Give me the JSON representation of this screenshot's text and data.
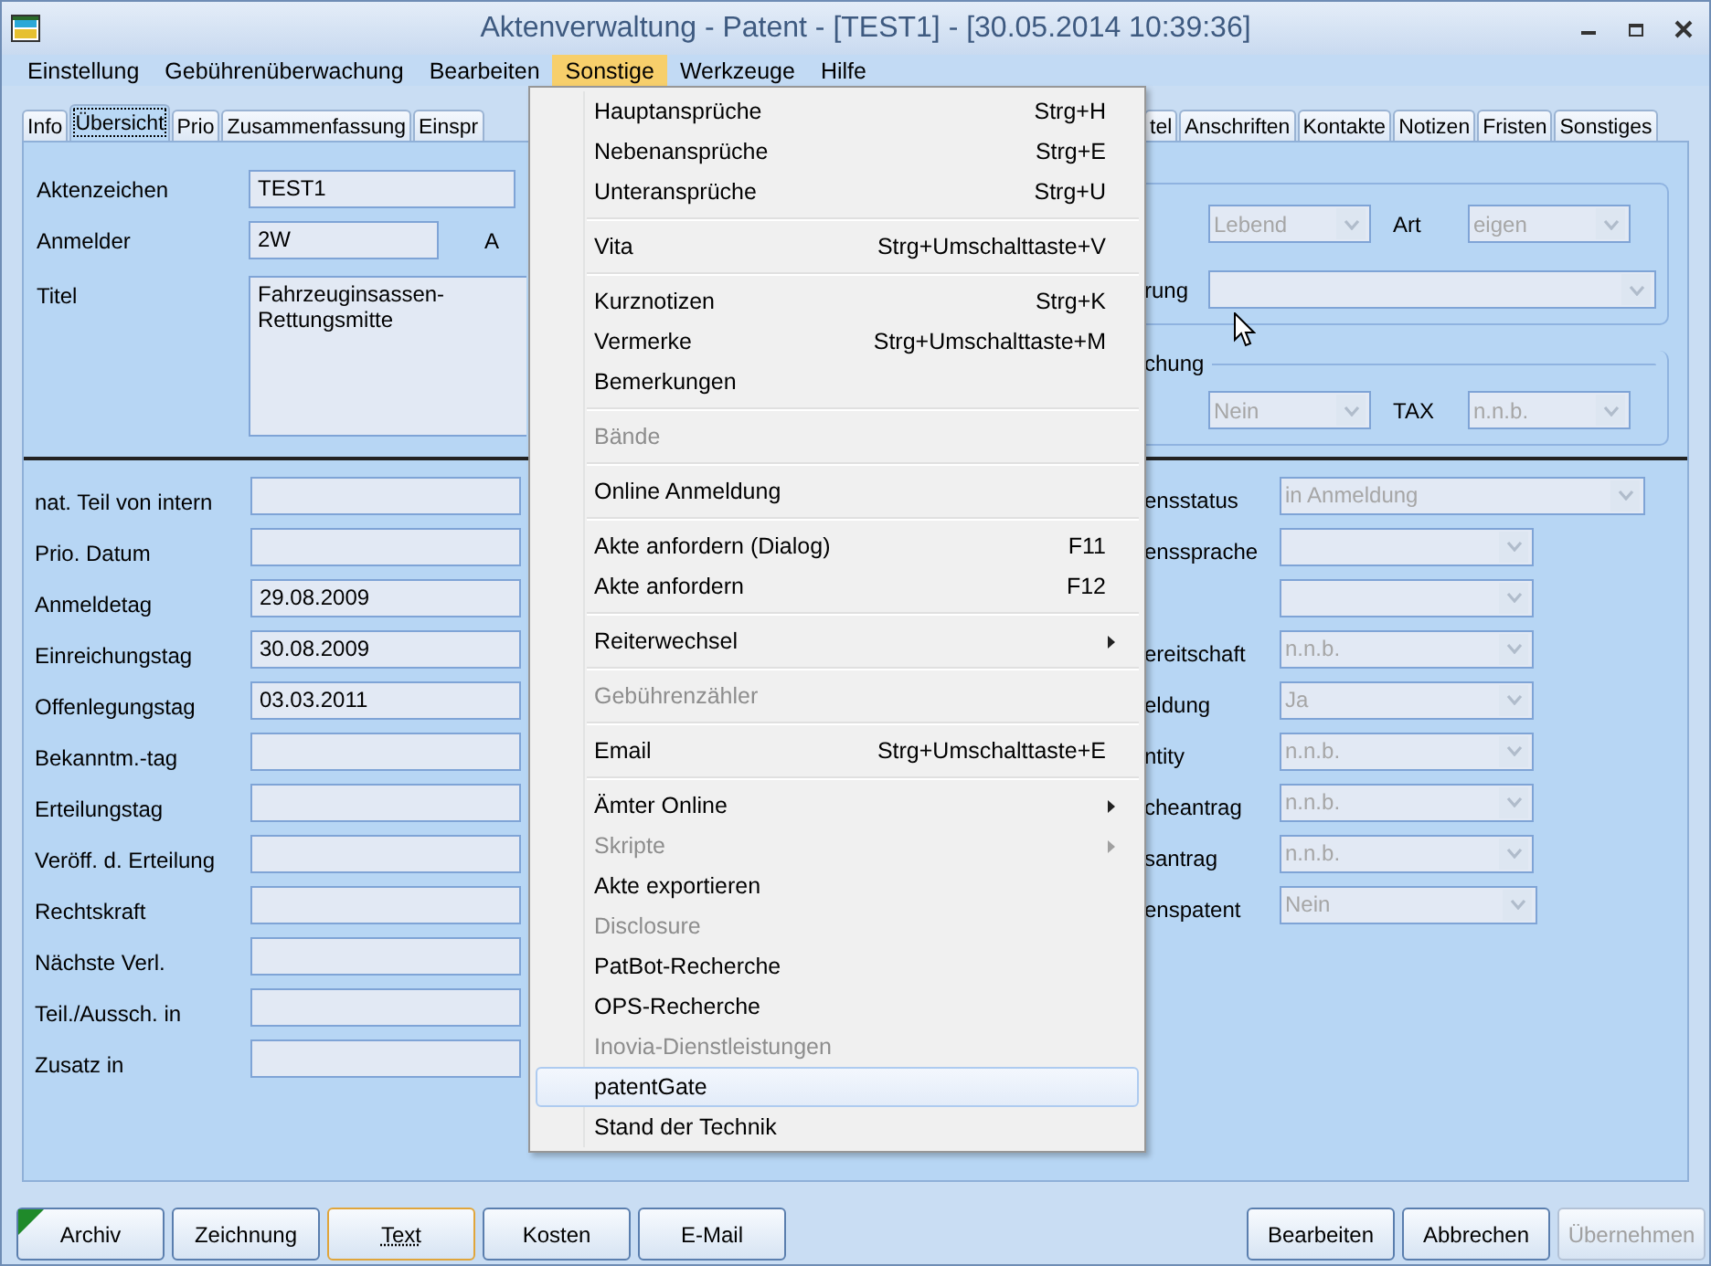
{
  "window": {
    "title": "Aktenverwaltung - Patent - [TEST1] - [30.05.2014 10:39:36]"
  },
  "menu_bar": [
    {
      "label": "Einstellung",
      "selected": false
    },
    {
      "label": "Gebührenüberwachung",
      "selected": false
    },
    {
      "label": "Bearbeiten",
      "selected": false
    },
    {
      "label": "Sonstige",
      "selected": true
    },
    {
      "label": "Werkzeuge",
      "selected": false
    },
    {
      "label": "Hilfe",
      "selected": false
    }
  ],
  "tabs": {
    "left_group": [
      {
        "label": "Info",
        "selected": false
      },
      {
        "label": "Übersicht",
        "selected": true
      },
      {
        "label": "Prio",
        "selected": false
      },
      {
        "label": "Zusammenfassung",
        "selected": false
      },
      {
        "label": "Einspr",
        "selected": false
      }
    ],
    "right_group": [
      {
        "label": "tel",
        "selected": false
      },
      {
        "label": "Anschriften",
        "selected": false
      },
      {
        "label": "Kontakte",
        "selected": false
      },
      {
        "label": "Notizen",
        "selected": false
      },
      {
        "label": "Fristen",
        "selected": false
      },
      {
        "label": "Sonstiges",
        "selected": false
      }
    ]
  },
  "header_fields": [
    {
      "kind": "text",
      "label": "Aktenzeichen",
      "value": "TEST1"
    },
    {
      "kind": "text",
      "label": "Anmelder",
      "value": "2W",
      "side_label": "A"
    },
    {
      "kind": "textarea",
      "label": "Titel",
      "value": "Fahrzeuginsassen-Rettungsmitte"
    }
  ],
  "right_groups": [
    {
      "rows": [
        {
          "combos": [
            {
              "value": "Lebend",
              "disabled": true
            },
            {
              "label": "Art",
              "value": "eigen",
              "disabled": true
            }
          ]
        },
        {
          "label": "rung",
          "combos": [
            {
              "disabled": true
            }
          ]
        }
      ]
    },
    {
      "title": "chung",
      "rows": [
        {
          "combos": [
            {
              "value": "Nein",
              "disabled": true
            },
            {
              "label": "TAX",
              "value": "n.n.b.",
              "disabled": true
            }
          ]
        }
      ]
    }
  ],
  "date_fields": [
    {
      "label": "nat. Teil von intern"
    },
    {
      "label": "Prio. Datum"
    },
    {
      "label": "Anmeldetag",
      "value": "29.08.2009"
    },
    {
      "label": "Einreichungstag",
      "value": "30.08.2009"
    },
    {
      "label": "Offenlegungstag",
      "value": "03.03.2011"
    },
    {
      "label": "Bekanntm.-tag"
    },
    {
      "label": "Erteilungstag"
    },
    {
      "label": "Veröff. d. Erteilung"
    },
    {
      "label": "Rechtskraft"
    },
    {
      "label": "Nächste Verl."
    },
    {
      "label": "Teil./Aussch. in"
    },
    {
      "label": "Zusatz in"
    }
  ],
  "status_fields": [
    {
      "label": "ensstatus",
      "value": "in Anmeldung",
      "disabled": true
    },
    {
      "label": "enssprache",
      "disabled": true
    },
    {
      "disabled": true
    },
    {
      "label": "ereitschaft",
      "value": "n.n.b.",
      "disabled": true
    },
    {
      "label": "eldung",
      "value": "Ja",
      "disabled": true
    },
    {
      "label": "ntity",
      "value": "n.n.b.",
      "disabled": true
    },
    {
      "label": "cheantrag",
      "value": "n.n.b.",
      "disabled": true
    },
    {
      "label": "santrag",
      "value": "n.n.b.",
      "disabled": true
    },
    {
      "label": "enspatent",
      "value": "Nein",
      "disabled": true
    }
  ],
  "dropdown_menu": [
    {
      "kind": "item",
      "label": "Hauptansprüche",
      "shortcut": "Strg+H",
      "disabled": false,
      "submenu": false,
      "selected": false
    },
    {
      "kind": "item",
      "label": "Nebenansprüche",
      "shortcut": "Strg+E",
      "disabled": false,
      "submenu": false,
      "selected": false
    },
    {
      "kind": "item",
      "label": "Unteransprüche",
      "shortcut": "Strg+U",
      "disabled": false,
      "submenu": false,
      "selected": false
    },
    {
      "kind": "separator"
    },
    {
      "kind": "item",
      "label": "Vita",
      "shortcut": "Strg+Umschalttaste+V",
      "disabled": false,
      "submenu": false,
      "selected": false
    },
    {
      "kind": "separator"
    },
    {
      "kind": "item",
      "label": "Kurznotizen",
      "shortcut": "Strg+K",
      "disabled": false,
      "submenu": false,
      "selected": false
    },
    {
      "kind": "item",
      "label": "Vermerke",
      "shortcut": "Strg+Umschalttaste+M",
      "disabled": false,
      "submenu": false,
      "selected": false
    },
    {
      "kind": "item",
      "label": "Bemerkungen",
      "disabled": false,
      "submenu": false,
      "selected": false
    },
    {
      "kind": "separator"
    },
    {
      "kind": "item",
      "label": "Bände",
      "disabled": true,
      "submenu": false,
      "selected": false
    },
    {
      "kind": "separator"
    },
    {
      "kind": "item",
      "label": "Online Anmeldung",
      "disabled": false,
      "submenu": false,
      "selected": false
    },
    {
      "kind": "separator"
    },
    {
      "kind": "item",
      "label": "Akte anfordern (Dialog)",
      "shortcut": "F11",
      "disabled": false,
      "submenu": false,
      "selected": false
    },
    {
      "kind": "item",
      "label": "Akte anfordern",
      "shortcut": "F12",
      "disabled": false,
      "submenu": false,
      "selected": false
    },
    {
      "kind": "separator"
    },
    {
      "kind": "item",
      "label": "Reiterwechsel",
      "disabled": false,
      "submenu": true,
      "selected": false
    },
    {
      "kind": "separator"
    },
    {
      "kind": "item",
      "label": "Gebührenzähler",
      "disabled": true,
      "submenu": false,
      "selected": false
    },
    {
      "kind": "separator"
    },
    {
      "kind": "item",
      "label": "Email",
      "shortcut": "Strg+Umschalttaste+E",
      "disabled": false,
      "submenu": false,
      "selected": false
    },
    {
      "kind": "separator"
    },
    {
      "kind": "item",
      "label": "Ämter Online",
      "disabled": false,
      "submenu": true,
      "selected": false
    },
    {
      "kind": "item",
      "label": "Skripte",
      "disabled": true,
      "submenu": true,
      "selected": false
    },
    {
      "kind": "item",
      "label": "Akte exportieren",
      "disabled": false,
      "submenu": false,
      "selected": false
    },
    {
      "kind": "item",
      "label": "Disclosure",
      "disabled": true,
      "submenu": false,
      "selected": false
    },
    {
      "kind": "item",
      "label": "PatBot-Recherche",
      "disabled": false,
      "submenu": false,
      "selected": false
    },
    {
      "kind": "item",
      "label": "OPS-Recherche",
      "disabled": false,
      "submenu": false,
      "selected": false
    },
    {
      "kind": "item",
      "label": "Inovia-Dienstleistungen",
      "disabled": true,
      "submenu": false,
      "selected": false
    },
    {
      "kind": "item",
      "label": "patentGate",
      "disabled": false,
      "submenu": false,
      "selected": true
    },
    {
      "kind": "item",
      "label": "Stand der Technik",
      "disabled": false,
      "submenu": false,
      "selected": false
    }
  ],
  "footer_buttons_left": [
    {
      "label": "Archiv",
      "focused": false,
      "flagged": true,
      "disabled": false
    },
    {
      "label": "Zeichnung",
      "focused": false,
      "flagged": false,
      "disabled": false
    },
    {
      "label": "Text",
      "focused": true,
      "flagged": false,
      "disabled": false
    },
    {
      "label": "Kosten",
      "focused": false,
      "flagged": false,
      "disabled": false
    },
    {
      "label": "E-Mail",
      "focused": false,
      "flagged": false,
      "disabled": false
    }
  ],
  "footer_buttons_right": [
    {
      "label": "Bearbeiten",
      "focused": false,
      "flagged": false,
      "disabled": false
    },
    {
      "label": "Abbrechen",
      "focused": false,
      "flagged": false,
      "disabled": false
    },
    {
      "label": "Übernehmen",
      "focused": false,
      "flagged": false,
      "disabled": true
    }
  ]
}
